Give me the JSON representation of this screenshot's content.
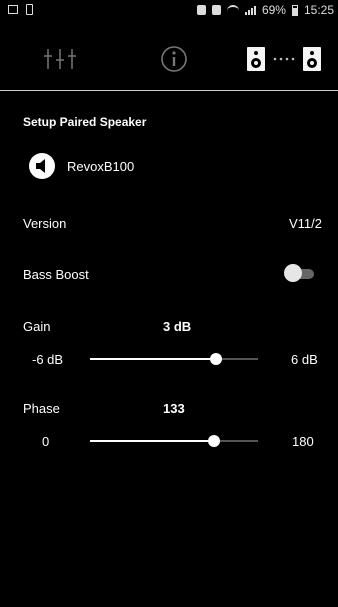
{
  "status": {
    "battery": "69%",
    "time": "15:25"
  },
  "toolbar": {
    "eq_icon": "equalizer-icon",
    "info_icon": "info-icon",
    "speakers_icon": "paired-speakers-icon"
  },
  "section": {
    "title": "Setup Paired Speaker"
  },
  "speaker": {
    "name": "RevoxB100",
    "icon": "speaker-icon"
  },
  "version": {
    "label": "Version",
    "value": "V11/2"
  },
  "bass_boost": {
    "label": "Bass Boost",
    "enabled": false
  },
  "gain": {
    "label": "Gain",
    "current": "3 dB",
    "min": "-6 dB",
    "max": "6 dB",
    "fraction": 0.75
  },
  "phase": {
    "label": "Phase",
    "current": "133",
    "min": "0",
    "max": "180",
    "fraction": 0.739
  }
}
